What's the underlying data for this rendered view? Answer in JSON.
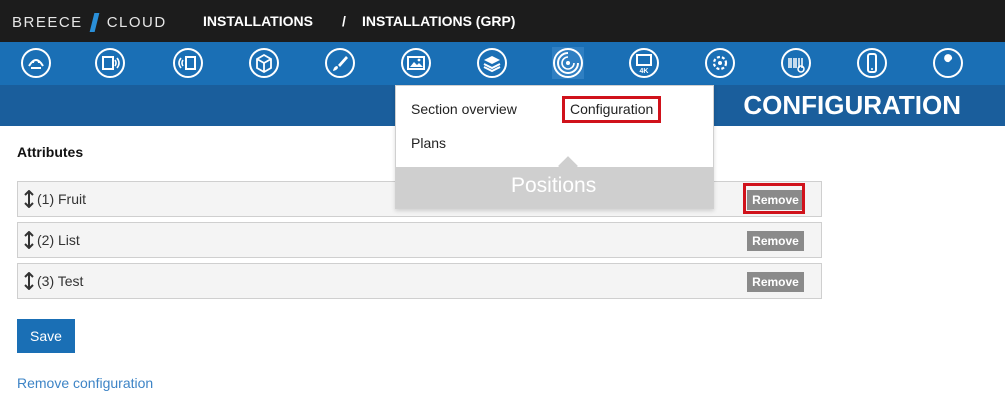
{
  "brand": {
    "left": "BREECE",
    "right": "CLOUD",
    "accent": "#2a8fd8"
  },
  "breadcrumb": {
    "root": "INSTALLATIONS",
    "separator": "/",
    "current": "INSTALLATIONS (GRP)"
  },
  "toolbar": {
    "icons": [
      "monitor-head-icon",
      "wall-sensor-icon",
      "door-sensor-icon",
      "box-icon",
      "brush-icon",
      "image-icon",
      "layers-icon",
      "disc-icon",
      "monitor-4k-icon",
      "gear-icon",
      "barcode-icon",
      "phone-icon",
      "wrench-icon"
    ],
    "active": "disc-icon"
  },
  "page": {
    "title": "CONFIGURATION"
  },
  "menu": {
    "items": [
      "Section overview",
      "Configuration",
      "Plans"
    ],
    "highlighted": "Configuration",
    "footer": "Positions"
  },
  "attributes": {
    "heading": "Attributes",
    "rows": [
      {
        "label": "(1) Fruit",
        "button": "Remove"
      },
      {
        "label": "(2) List",
        "button": "Remove"
      },
      {
        "label": "(3) Test",
        "button": "Remove"
      }
    ]
  },
  "actions": {
    "save": "Save",
    "remove_config": "Remove configuration"
  },
  "colors": {
    "topbar": "#1c1c1c",
    "iconbar": "#1a6fb5",
    "band": "#1a5e9c",
    "highlight": "#d0121b",
    "link": "#3d84c6"
  }
}
